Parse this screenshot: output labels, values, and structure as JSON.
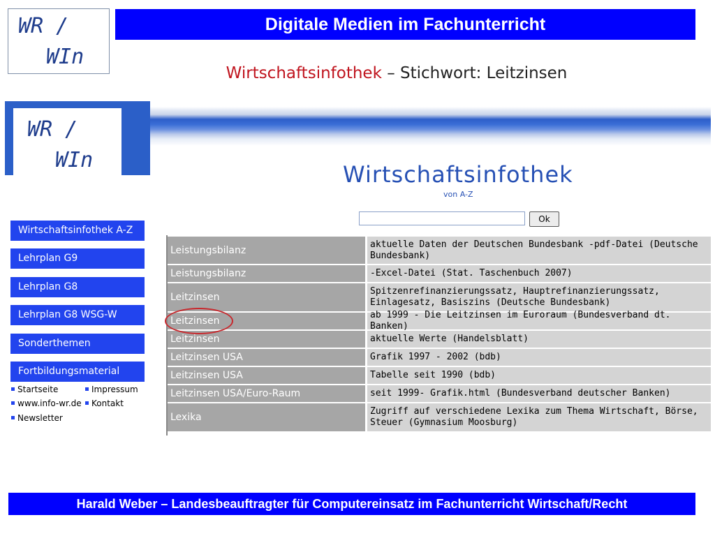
{
  "slide": {
    "logo_line1": "WR /",
    "logo_line2": "WIn",
    "title": "Digitale Medien im Fachunterricht",
    "subtitle_red": "Wirtschaftsinfothek",
    "subtitle_rest": " – Stichwort: Leitzinsen",
    "footer": "Harald Weber – Landesbeauftragter für Computereinsatz im Fachunterricht Wirtschaft/Recht",
    "colors": {
      "title_bar": "#0000ff",
      "subtitle_red": "#c0141e",
      "nav_button": "#2244ee",
      "highlight_ring": "#c8282d"
    }
  },
  "site": {
    "logo_line1": "WR /",
    "logo_line2": "WIn",
    "brand_title": "Wirtschaftsinfothek",
    "brand_sub": "von A-Z",
    "search": {
      "value": "",
      "button_label": "Ok"
    },
    "nav": [
      {
        "label": "Wirtschaftsinfothek A-Z"
      },
      {
        "label": "Lehrplan G9"
      },
      {
        "label": "Lehrplan G8"
      },
      {
        "label": "Lehrplan G8 WSG-W"
      },
      {
        "label": "Sonderthemen"
      },
      {
        "label": "Fortbildungsmaterial"
      }
    ],
    "sublinks": [
      {
        "label": "Startseite"
      },
      {
        "label": "Impressum"
      },
      {
        "label": "www.info-wr.de"
      },
      {
        "label": "Kontakt"
      },
      {
        "label": "Newsletter"
      }
    ],
    "table": [
      {
        "key": "Leistungsbilanz",
        "desc": "aktuelle Daten der Deutschen Bundesbank -pdf-Datei (Deutsche Bundesbank)"
      },
      {
        "key": "Leistungsbilanz",
        "desc": "-Excel-Datei (Stat. Taschenbuch 2007)"
      },
      {
        "key": "Leitzinsen",
        "desc": "Spitzenrefinanzierungssatz, Hauptrefinanzierungssatz, Einlagesatz, Basiszins (Deutsche Bundesbank)"
      },
      {
        "key": "Leitzinsen",
        "desc": "ab 1999 - Die Leitzinsen im Euroraum (Bundesverband dt. Banken)"
      },
      {
        "key": "Leitzinsen",
        "desc": "aktuelle Werte (Handelsblatt)"
      },
      {
        "key": "Leitzinsen USA",
        "desc": "Grafik 1997 - 2002 (bdb)"
      },
      {
        "key": "Leitzinsen USA",
        "desc": "Tabelle seit 1990 (bdb)"
      },
      {
        "key": "Leitzinsen USA/Euro-Raum",
        "desc": "seit 1999- Grafik.html (Bundesverband deutscher Banken)"
      },
      {
        "key": "Lexika",
        "desc": "Zugriff auf verschiedene Lexika zum Thema Wirtschaft, Börse, Steuer (Gymnasium Moosburg)"
      }
    ]
  }
}
